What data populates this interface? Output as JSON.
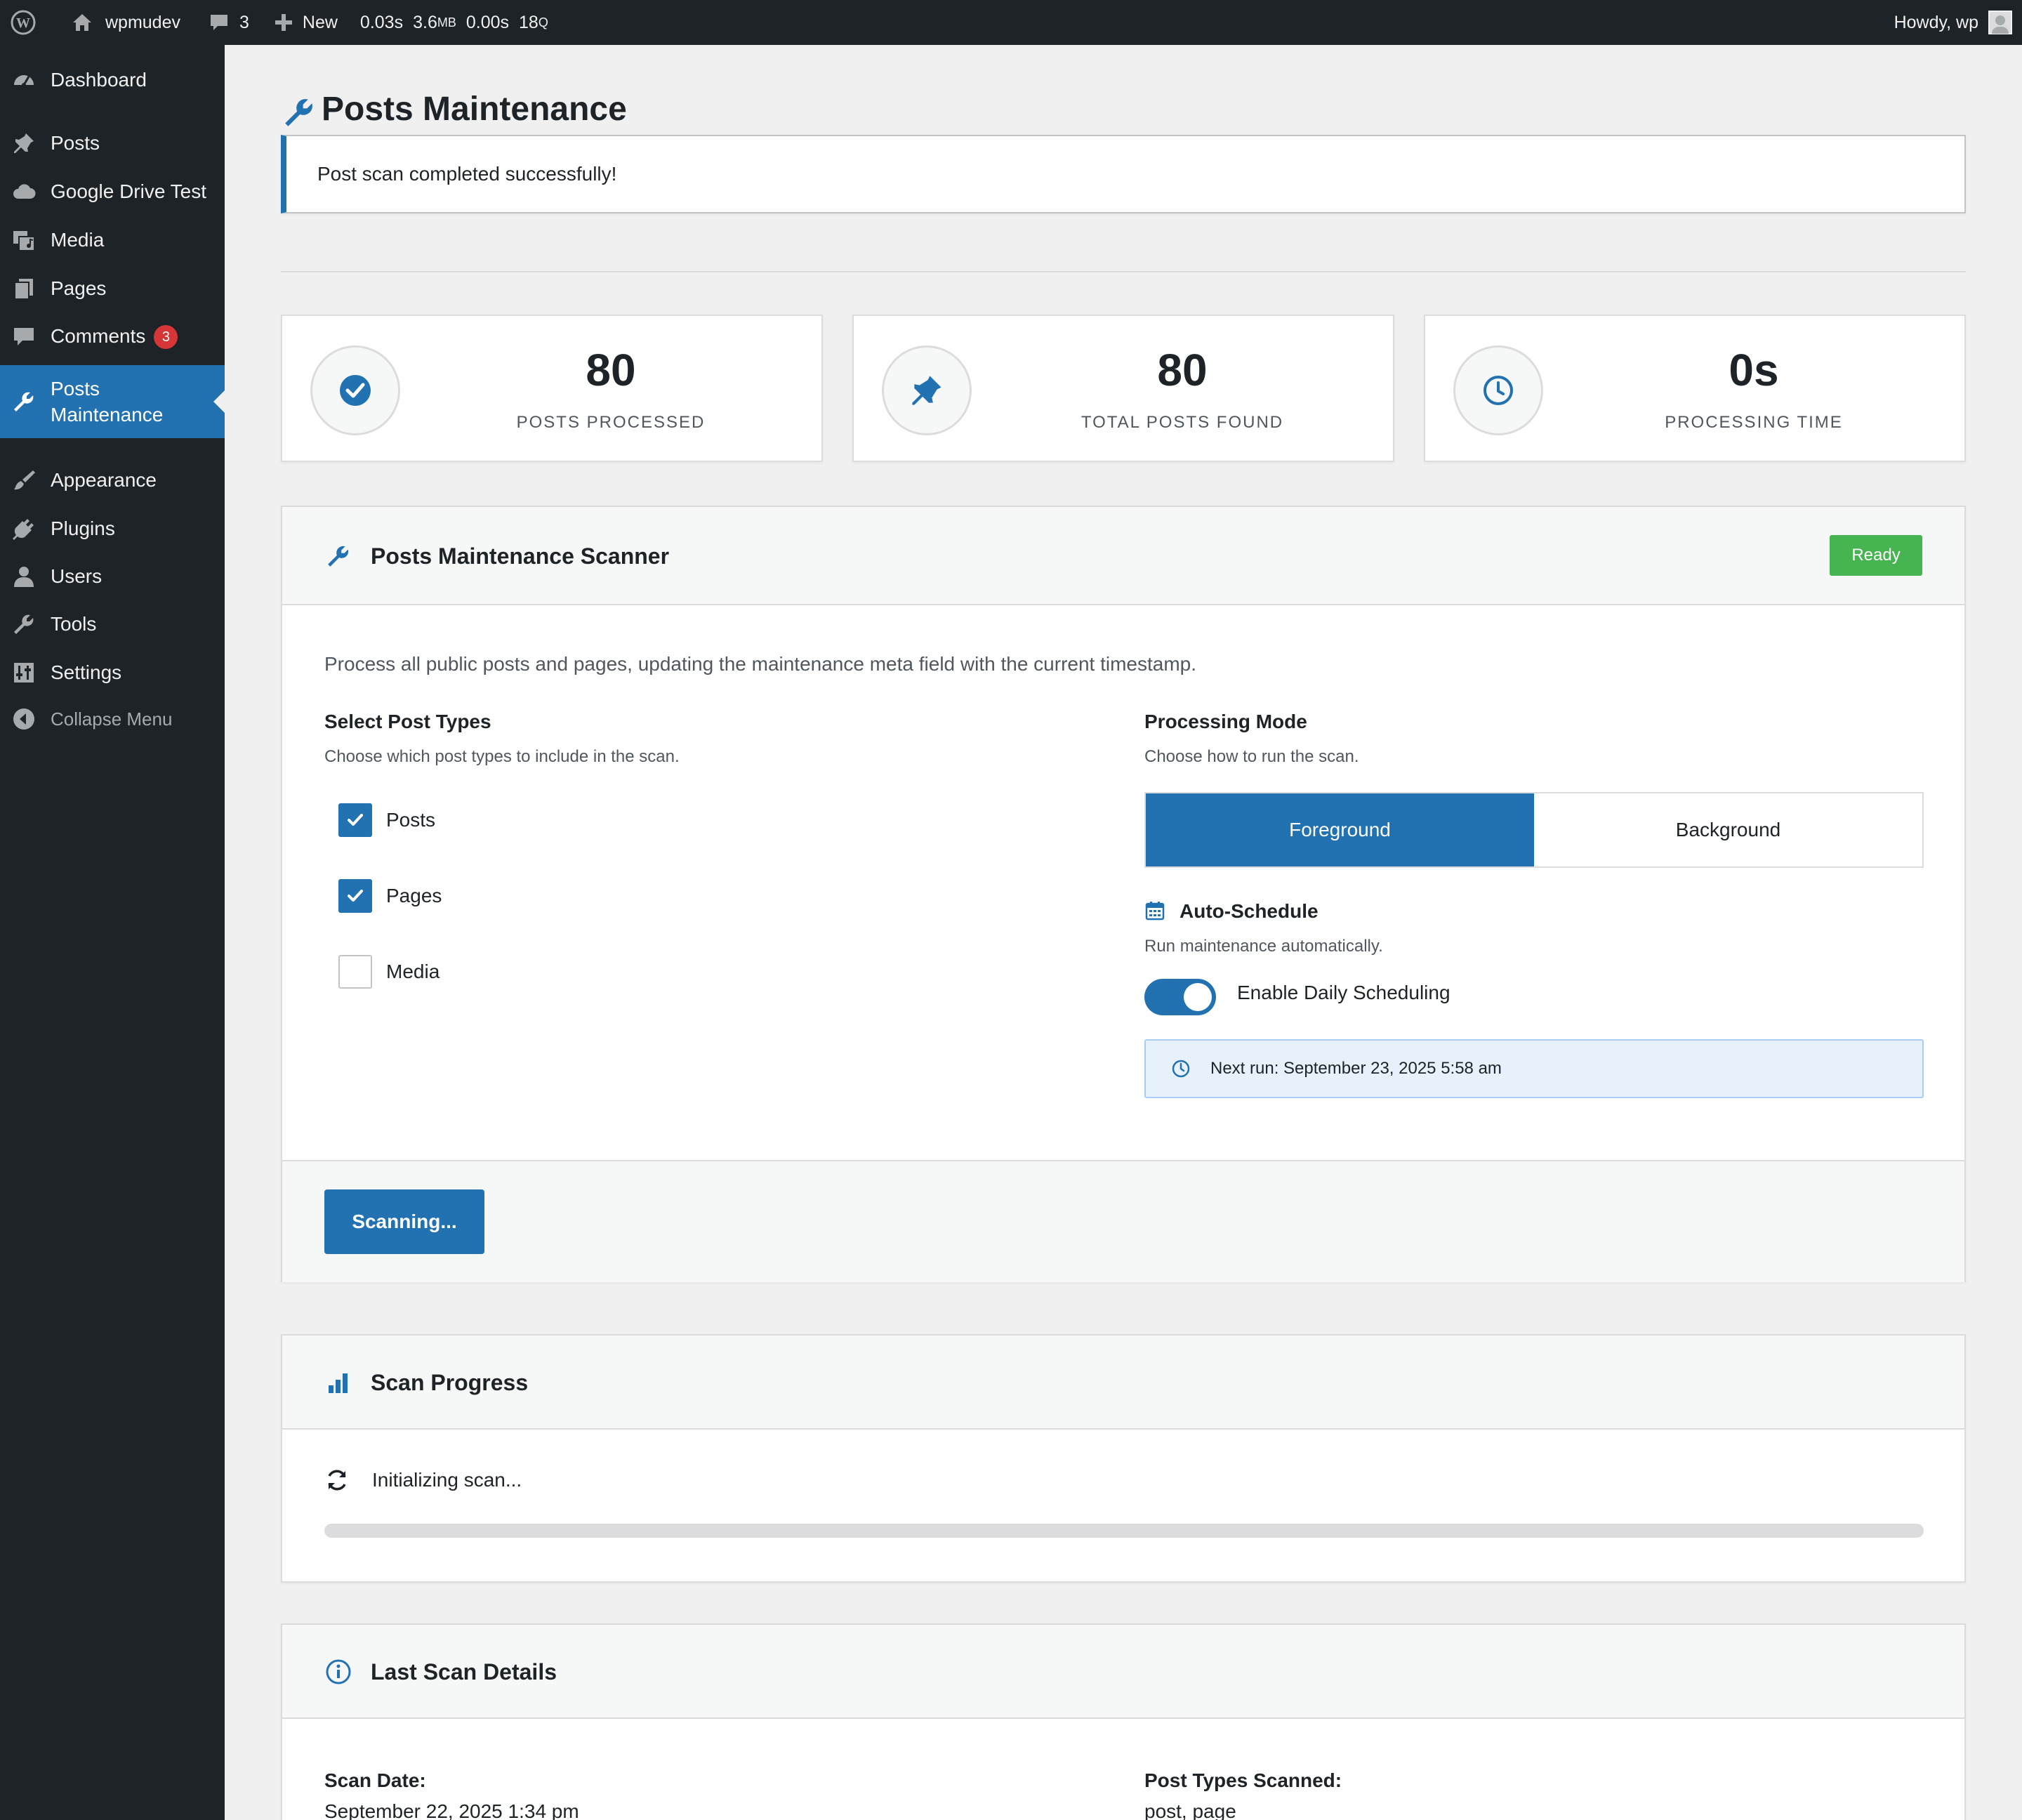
{
  "adminbar": {
    "site_name": "wpmudev",
    "comments_count": "3",
    "new_label": "New",
    "perf_time": "0.03s",
    "perf_mem": "3.6",
    "perf_mem_unit": "MB",
    "perf_db_time": "0.00s",
    "perf_queries": "18",
    "perf_queries_unit": "Q",
    "howdy": "Howdy, wp",
    "icons": [
      "wordpress-logo-icon",
      "home-icon",
      "comment-icon",
      "plus-icon"
    ]
  },
  "sidebar": {
    "items": [
      {
        "label": "Dashboard",
        "icon": "dashboard-icon"
      },
      {
        "label": "Posts",
        "icon": "pushpin-icon"
      },
      {
        "label": "Google Drive Test",
        "icon": "cloud-icon"
      },
      {
        "label": "Media",
        "icon": "media-icon"
      },
      {
        "label": "Pages",
        "icon": "pages-icon"
      },
      {
        "label": "Comments",
        "icon": "comment-icon",
        "badge": "3"
      },
      {
        "label": "Posts\nMaintenance",
        "icon": "wrench-icon",
        "active": true
      },
      {
        "label": "Appearance",
        "icon": "brush-icon"
      },
      {
        "label": "Plugins",
        "icon": "plug-icon"
      },
      {
        "label": "Users",
        "icon": "user-icon"
      },
      {
        "label": "Tools",
        "icon": "wrench-icon"
      },
      {
        "label": "Settings",
        "icon": "sliders-icon"
      },
      {
        "label": "Collapse Menu",
        "icon": "collapse-arrow-icon"
      }
    ]
  },
  "page": {
    "title": "Posts Maintenance",
    "notice": "Post scan completed successfully!"
  },
  "stats": [
    {
      "value": "80",
      "label": "POSTS PROCESSED",
      "icon": "check-circle-icon"
    },
    {
      "value": "80",
      "label": "TOTAL POSTS FOUND",
      "icon": "pushpin-icon"
    },
    {
      "value": "0s",
      "label": "PROCESSING TIME",
      "icon": "clock-icon"
    }
  ],
  "scanner": {
    "title": "Posts Maintenance Scanner",
    "status": "Ready",
    "description": "Process all public posts and pages, updating the maintenance meta field with the current timestamp.",
    "post_types_title": "Select Post Types",
    "post_types_desc": "Choose which post types to include in the scan.",
    "post_types": [
      {
        "label": "Posts",
        "checked": true
      },
      {
        "label": "Pages",
        "checked": true
      },
      {
        "label": "Media",
        "checked": false
      }
    ],
    "mode_title": "Processing Mode",
    "mode_desc": "Choose how to run the scan.",
    "modes": [
      {
        "label": "Foreground",
        "active": true
      },
      {
        "label": "Background",
        "active": false
      }
    ],
    "schedule_title": "Auto-Schedule",
    "schedule_desc": "Run maintenance automatically.",
    "schedule_toggle_label": "Enable Daily Scheduling",
    "schedule_enabled": true,
    "next_run": "Next run: September 23, 2025 5:58 am",
    "scan_button": "Scanning..."
  },
  "progress": {
    "title": "Scan Progress",
    "status": "Initializing scan...",
    "percent": 0
  },
  "last_scan": {
    "title": "Last Scan Details",
    "scan_date_label": "Scan Date:",
    "scan_date_value": "September 22, 2025 1:34 pm",
    "types_label": "Post Types Scanned:",
    "types_value": "post, page"
  },
  "colors": {
    "accent": "#2271b1",
    "adminbar_bg": "#1d2327",
    "success": "#46b450",
    "badge": "#d63638"
  }
}
